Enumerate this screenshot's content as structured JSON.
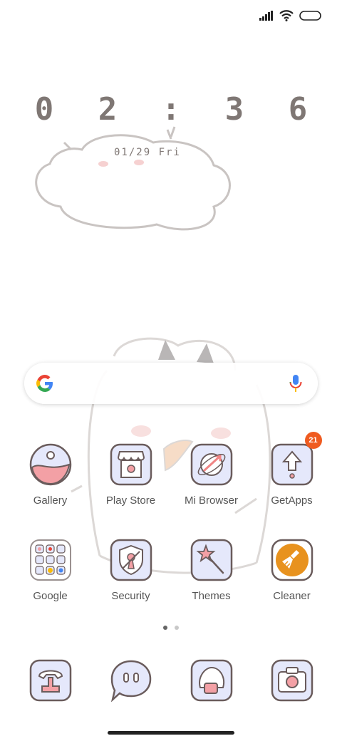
{
  "clock": {
    "time": "0 2 : 3 6",
    "date": "01/29 Fri"
  },
  "status": {
    "signal_icon": "signal-bars-icon",
    "wifi_icon": "wifi-icon",
    "battery_icon": "battery-icon"
  },
  "search": {
    "logo_icon": "google-g-icon",
    "mic_icon": "microphone-icon"
  },
  "apps": [
    {
      "label": "Gallery",
      "icon": "gallery-icon"
    },
    {
      "label": "Play Store",
      "icon": "play-store-icon"
    },
    {
      "label": "Mi Browser",
      "icon": "mi-browser-icon"
    },
    {
      "label": "GetApps",
      "icon": "getapps-icon",
      "badge": "21"
    },
    {
      "label": "Google",
      "icon": "google-folder-icon"
    },
    {
      "label": "Security",
      "icon": "security-icon"
    },
    {
      "label": "Themes",
      "icon": "themes-icon"
    },
    {
      "label": "Cleaner",
      "icon": "cleaner-icon"
    }
  ],
  "pages": {
    "count": 2,
    "active": 1
  },
  "dock": [
    "phone-icon",
    "messages-icon",
    "contacts-icon",
    "camera-icon"
  ],
  "colors": {
    "icon_fill": "#e5e8fb",
    "icon_stroke": "#6a5c5c",
    "accent_pink": "#f3a0a5",
    "cleaner_orange": "#e8921e",
    "badge": "#ef5b20"
  }
}
